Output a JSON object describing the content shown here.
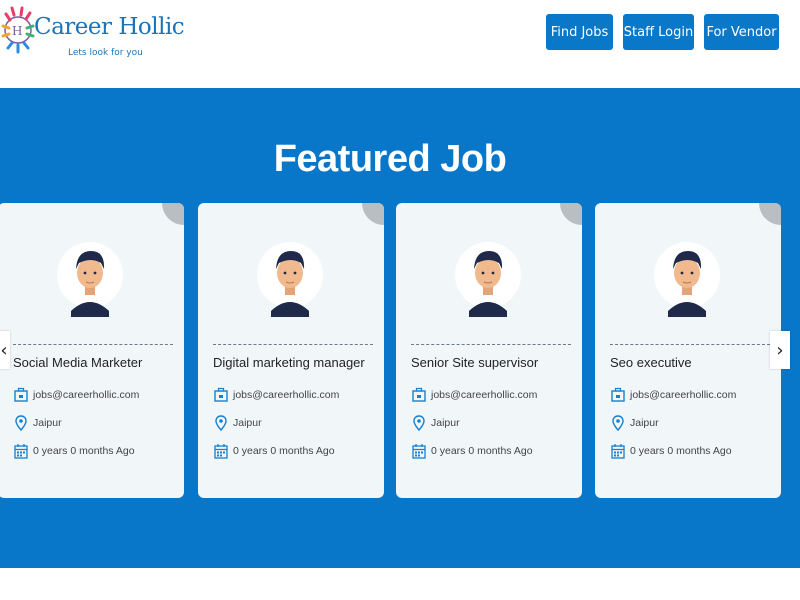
{
  "header": {
    "brand": "Career Hollic",
    "tagline": "Lets look for you",
    "nav": [
      "Find Jobs",
      "Staff Login",
      "For Vendor"
    ]
  },
  "main": {
    "title": "Featured Job",
    "jobs": [
      {
        "title": "Social Media Marketer",
        "email": "jobs@careerhollic.com",
        "location": "Jaipur",
        "posted": "0 years 0 months Ago"
      },
      {
        "title": "Digital marketing manager",
        "email": "jobs@careerhollic.com",
        "location": "Jaipur",
        "posted": "0 years 0 months Ago"
      },
      {
        "title": "Senior Site supervisor",
        "email": "jobs@careerhollic.com",
        "location": "Jaipur",
        "posted": "0 years 0 months Ago"
      },
      {
        "title": "Seo executive",
        "email": "jobs@careerhollic.com",
        "location": "Jaipur",
        "posted": "0 years 0 months Ago"
      }
    ],
    "carousel": {
      "prev": "‹",
      "next": "›",
      "card_arrow": "→"
    }
  },
  "colors": {
    "brand_blue": "#0877c9",
    "button_blue": "#0a78c9",
    "card_bg": "#f1f6f9"
  },
  "icons": [
    "briefcase-icon",
    "location-pin-icon",
    "calendar-icon",
    "avatar-icon",
    "arrow-right-icon",
    "chevron-left-icon",
    "chevron-right-icon"
  ]
}
